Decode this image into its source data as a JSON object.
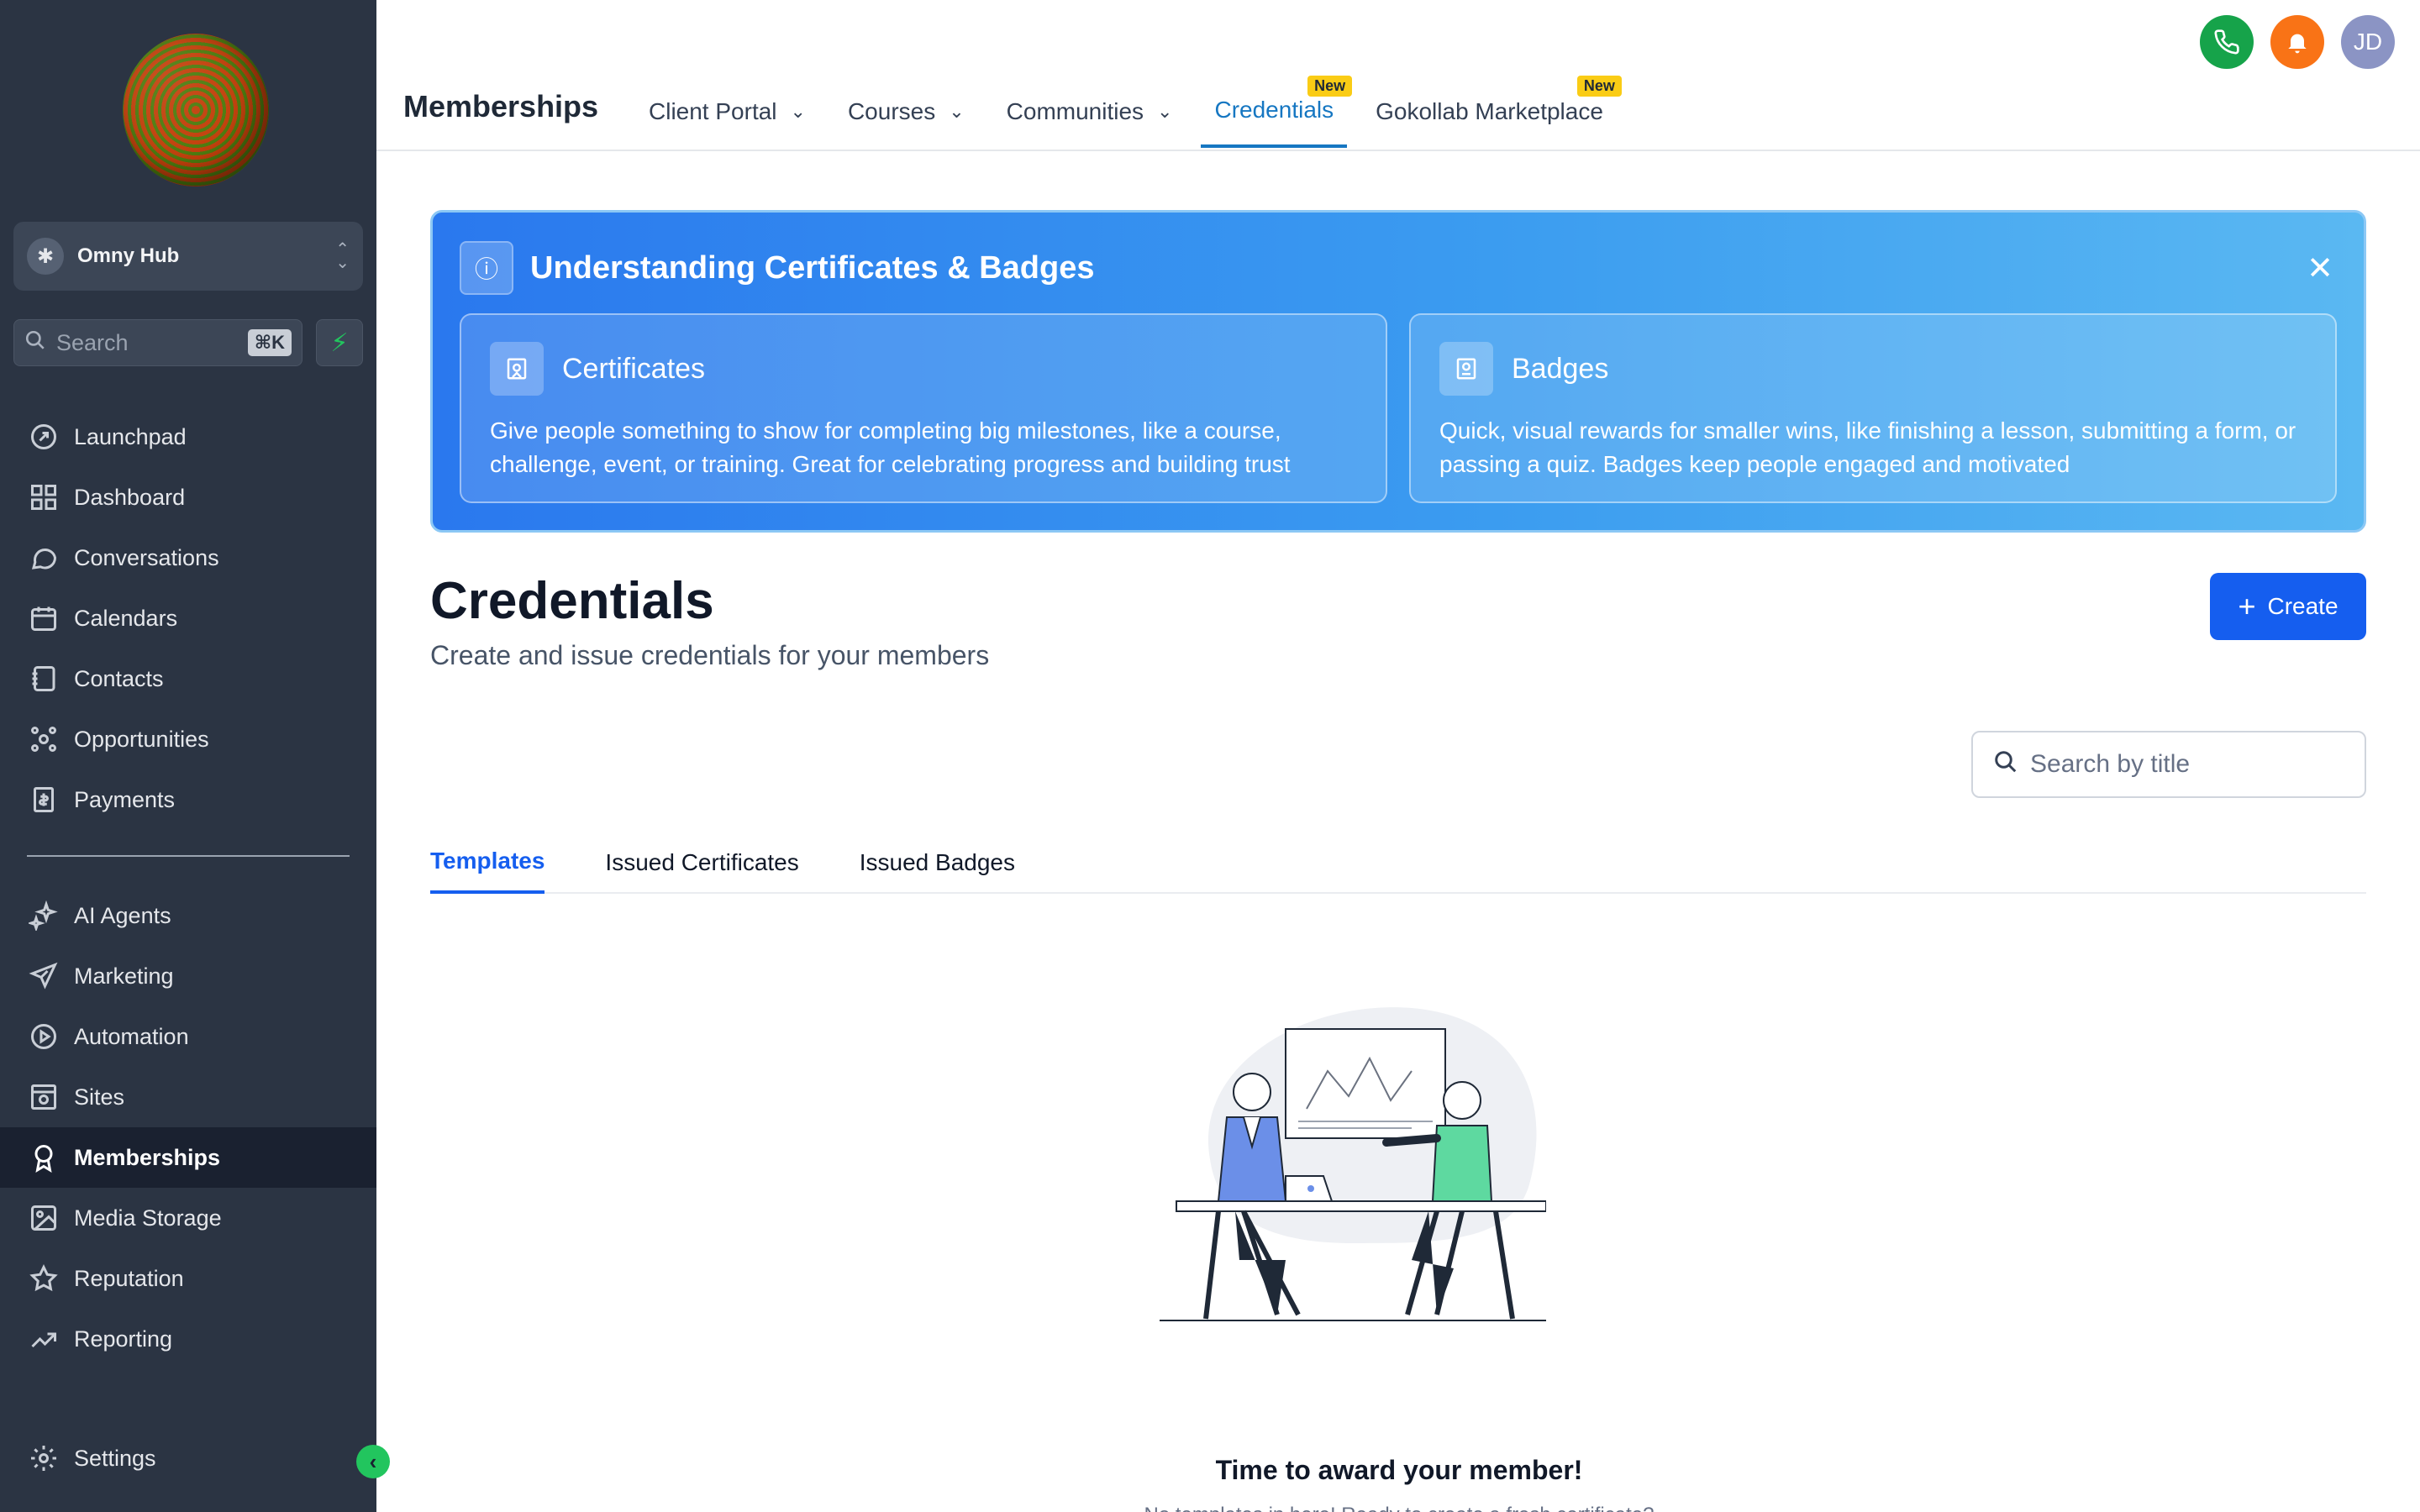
{
  "sidebar": {
    "hub_name": "Omny Hub",
    "search_placeholder": "Search",
    "search_shortcut": "⌘K",
    "nav_top": [
      {
        "label": "Launchpad",
        "icon": "launchpad-icon"
      },
      {
        "label": "Dashboard",
        "icon": "dashboard-icon"
      },
      {
        "label": "Conversations",
        "icon": "chat-icon"
      },
      {
        "label": "Calendars",
        "icon": "calendar-icon"
      },
      {
        "label": "Contacts",
        "icon": "contacts-icon"
      },
      {
        "label": "Opportunities",
        "icon": "opportunities-icon"
      },
      {
        "label": "Payments",
        "icon": "payments-icon"
      }
    ],
    "nav_bottom": [
      {
        "label": "AI Agents",
        "icon": "sparkle-icon"
      },
      {
        "label": "Marketing",
        "icon": "send-icon"
      },
      {
        "label": "Automation",
        "icon": "automation-icon"
      },
      {
        "label": "Sites",
        "icon": "sites-icon"
      },
      {
        "label": "Memberships",
        "icon": "award-icon",
        "active": true
      },
      {
        "label": "Media Storage",
        "icon": "image-icon"
      },
      {
        "label": "Reputation",
        "icon": "star-icon"
      },
      {
        "label": "Reporting",
        "icon": "trend-icon"
      }
    ],
    "settings_label": "Settings",
    "accent_color": "#22c55e"
  },
  "topbar": {
    "page_label": "Memberships",
    "tabs": [
      {
        "label": "Client Portal",
        "has_dropdown": true
      },
      {
        "label": "Courses",
        "has_dropdown": true
      },
      {
        "label": "Communities",
        "has_dropdown": true
      },
      {
        "label": "Credentials",
        "badge": "New",
        "active": true
      },
      {
        "label": "Gokollab Marketplace",
        "badge": "New"
      }
    ],
    "avatar_initials": "JD"
  },
  "banner": {
    "title": "Understanding Certificates & Badges",
    "cards": [
      {
        "title": "Certificates",
        "text": "Give people something to show for completing big milestones, like a course, challenge, event, or training. Great for celebrating progress and building trust"
      },
      {
        "title": "Badges",
        "text": "Quick, visual rewards for smaller wins, like finishing a lesson, submitting a form, or passing a quiz. Badges keep people engaged and motivated"
      }
    ]
  },
  "main": {
    "title": "Credentials",
    "subtitle": "Create and issue credentials for your members",
    "create_label": "Create",
    "search_placeholder": "Search by title",
    "tabs": [
      {
        "label": "Templates",
        "active": true
      },
      {
        "label": "Issued Certificates"
      },
      {
        "label": "Issued Badges"
      }
    ],
    "empty_title": "Time to award your member!",
    "empty_subtitle": "No templates in here! Ready to create a fresh certificate?"
  },
  "colors": {
    "primary": "#155eef",
    "active_tab": "#1677c2",
    "sidebar_bg": "#2b3443",
    "new_badge": "#facc15"
  }
}
